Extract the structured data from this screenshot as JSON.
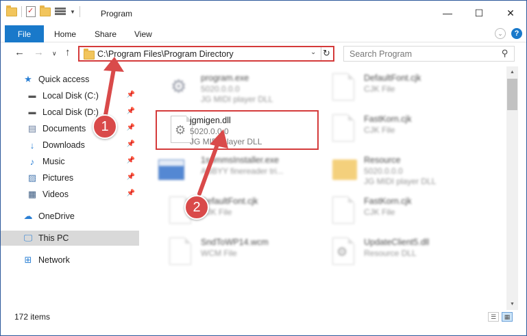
{
  "window": {
    "title": "Program",
    "controls": {
      "minimize": "—",
      "maximize": "☐",
      "close": "✕"
    }
  },
  "ribbon": {
    "file": "File",
    "tabs": [
      "Home",
      "Share",
      "View"
    ],
    "help": "?"
  },
  "nav": {
    "address": "C:\\Program Files\\Program Directory",
    "search_placeholder": "Search Program"
  },
  "sidebar": {
    "items": [
      {
        "label": "Quick access",
        "icon": "star-icon",
        "pinned": false
      },
      {
        "label": "Local Disk (C:)",
        "icon": "drive-icon",
        "pinned": true
      },
      {
        "label": "Local Disk (D:)",
        "icon": "drive-icon",
        "pinned": true
      },
      {
        "label": "Documents",
        "icon": "documents-icon",
        "pinned": true
      },
      {
        "label": "Downloads",
        "icon": "download-icon",
        "pinned": true
      },
      {
        "label": "Music",
        "icon": "music-icon",
        "pinned": true
      },
      {
        "label": "Pictures",
        "icon": "pictures-icon",
        "pinned": true
      },
      {
        "label": "Videos",
        "icon": "videos-icon",
        "pinned": true
      },
      {
        "label": "OneDrive",
        "icon": "cloud-icon",
        "pinned": false
      },
      {
        "label": "This PC",
        "icon": "computer-icon",
        "pinned": false,
        "selected": true
      },
      {
        "label": "Network",
        "icon": "network-icon",
        "pinned": false
      }
    ]
  },
  "files": [
    {
      "name": "program.exe",
      "line1": "5020.0.0.0",
      "line2": "JG MIDI player DLL",
      "icon": "exe"
    },
    {
      "name": "DefaultFont.cjk",
      "line1": "CJK File",
      "line2": "",
      "icon": "file"
    },
    {
      "name": "jgmigen.dll",
      "line1": "5020.0.0.0",
      "line2": "JG MIDI player DLL",
      "icon": "dll"
    },
    {
      "name": "FastKorn.cjk",
      "line1": "CJK File",
      "line2": "",
      "icon": "file"
    },
    {
      "name": "1sommsInstaller.exe",
      "line1": "ABBYY finereader tri...",
      "line2": "",
      "icon": "installer"
    },
    {
      "name": "Resource",
      "line1": "5020.0.0.0",
      "line2": "JG MIDI player DLL",
      "icon": "folder"
    },
    {
      "name": "DefaultFont.cjk",
      "line1": "CJK File",
      "line2": "",
      "icon": "file"
    },
    {
      "name": "FastKorn.cjk",
      "line1": "CJK File",
      "line2": "",
      "icon": "file"
    },
    {
      "name": "SndToWP14.wcm",
      "line1": "WCM File",
      "line2": "",
      "icon": "file"
    },
    {
      "name": "UpdateClient5.dll",
      "line1": "Resource DLL",
      "line2": "",
      "icon": "dll"
    }
  ],
  "status": {
    "items": "172 items"
  },
  "callouts": {
    "one": "1",
    "two": "2"
  },
  "colors": {
    "accent": "#1979ca",
    "highlight": "#d43a3a",
    "badge": "#d94a4a"
  }
}
